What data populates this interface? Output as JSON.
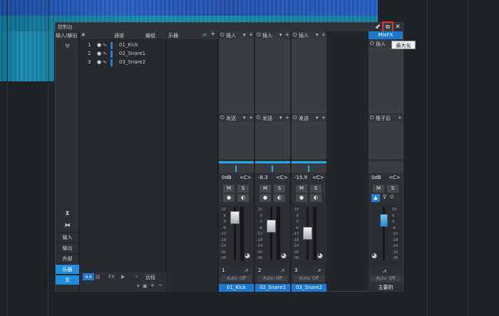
{
  "window": {
    "title": "控制台"
  },
  "nav": {
    "io_label": "输入/输出",
    "buttons": [
      "输入",
      "输出",
      "外部",
      "乐器"
    ]
  },
  "tracklist": {
    "col_hash": "#",
    "col_channel": "通道",
    "col_group": "编组",
    "tracks": [
      {
        "num": "1",
        "name": "01_Kick"
      },
      {
        "num": "2",
        "name": "02_Snare1"
      },
      {
        "num": "3",
        "name": "03_Snare2"
      }
    ],
    "footer": {
      "remote": "远程",
      "fx": "FX"
    }
  },
  "instruments": {
    "header": "乐器"
  },
  "strips": [
    {
      "inserts": "插入",
      "sends": "发送",
      "volume": "0dB",
      "pan": "<C>",
      "mute": "M",
      "solo": "S",
      "number": "1",
      "auto": "Auto: Off",
      "name": "01_Kick"
    },
    {
      "inserts": "插入",
      "sends": "发送",
      "volume": "-8.3",
      "pan": "<C>",
      "mute": "M",
      "solo": "S",
      "number": "2",
      "auto": "Auto: Off",
      "name": "02_Snare1"
    },
    {
      "inserts": "插入",
      "sends": "发送",
      "volume": "-15.9",
      "pan": "<C>",
      "mute": "M",
      "solo": "S",
      "number": "3",
      "auto": "Auto: Off",
      "name": "03_Snare2"
    }
  ],
  "main": {
    "header": "MixFX",
    "inserts": "插入",
    "post": "推子后",
    "volume": "0dB",
    "pan": "<C>",
    "mute": "M",
    "solo": "S",
    "auto": "Auto: Off",
    "name": "主要的"
  },
  "scale": [
    "10",
    "6",
    "0",
    "-6",
    "-12",
    "-18",
    "-24",
    "-30",
    "-36",
    "-48",
    "-72"
  ],
  "tooltip": "最大化",
  "colors": {
    "accent": "#1d78d0",
    "highlight": "#e03030"
  }
}
